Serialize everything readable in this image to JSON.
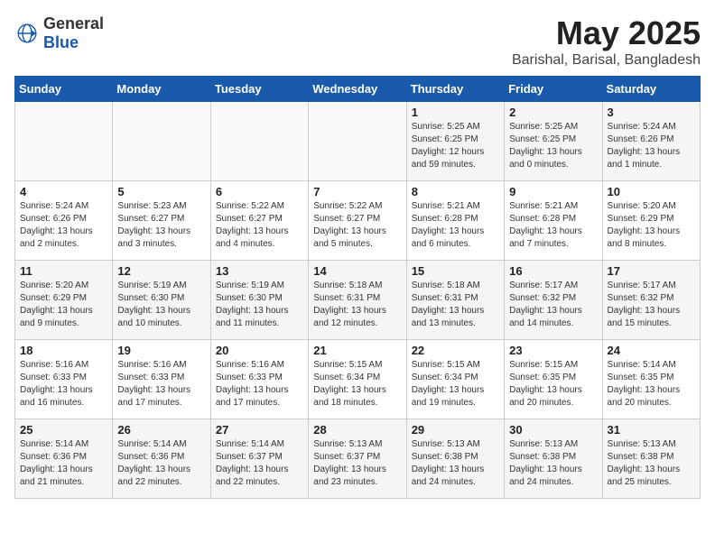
{
  "logo": {
    "text_general": "General",
    "text_blue": "Blue"
  },
  "header": {
    "month_title": "May 2025",
    "location": "Barishal, Barisal, Bangladesh"
  },
  "weekdays": [
    "Sunday",
    "Monday",
    "Tuesday",
    "Wednesday",
    "Thursday",
    "Friday",
    "Saturday"
  ],
  "weeks": [
    [
      {
        "day": "",
        "info": ""
      },
      {
        "day": "",
        "info": ""
      },
      {
        "day": "",
        "info": ""
      },
      {
        "day": "",
        "info": ""
      },
      {
        "day": "1",
        "info": "Sunrise: 5:25 AM\nSunset: 6:25 PM\nDaylight: 12 hours\nand 59 minutes."
      },
      {
        "day": "2",
        "info": "Sunrise: 5:25 AM\nSunset: 6:25 PM\nDaylight: 13 hours\nand 0 minutes."
      },
      {
        "day": "3",
        "info": "Sunrise: 5:24 AM\nSunset: 6:26 PM\nDaylight: 13 hours\nand 1 minute."
      }
    ],
    [
      {
        "day": "4",
        "info": "Sunrise: 5:24 AM\nSunset: 6:26 PM\nDaylight: 13 hours\nand 2 minutes."
      },
      {
        "day": "5",
        "info": "Sunrise: 5:23 AM\nSunset: 6:27 PM\nDaylight: 13 hours\nand 3 minutes."
      },
      {
        "day": "6",
        "info": "Sunrise: 5:22 AM\nSunset: 6:27 PM\nDaylight: 13 hours\nand 4 minutes."
      },
      {
        "day": "7",
        "info": "Sunrise: 5:22 AM\nSunset: 6:27 PM\nDaylight: 13 hours\nand 5 minutes."
      },
      {
        "day": "8",
        "info": "Sunrise: 5:21 AM\nSunset: 6:28 PM\nDaylight: 13 hours\nand 6 minutes."
      },
      {
        "day": "9",
        "info": "Sunrise: 5:21 AM\nSunset: 6:28 PM\nDaylight: 13 hours\nand 7 minutes."
      },
      {
        "day": "10",
        "info": "Sunrise: 5:20 AM\nSunset: 6:29 PM\nDaylight: 13 hours\nand 8 minutes."
      }
    ],
    [
      {
        "day": "11",
        "info": "Sunrise: 5:20 AM\nSunset: 6:29 PM\nDaylight: 13 hours\nand 9 minutes."
      },
      {
        "day": "12",
        "info": "Sunrise: 5:19 AM\nSunset: 6:30 PM\nDaylight: 13 hours\nand 10 minutes."
      },
      {
        "day": "13",
        "info": "Sunrise: 5:19 AM\nSunset: 6:30 PM\nDaylight: 13 hours\nand 11 minutes."
      },
      {
        "day": "14",
        "info": "Sunrise: 5:18 AM\nSunset: 6:31 PM\nDaylight: 13 hours\nand 12 minutes."
      },
      {
        "day": "15",
        "info": "Sunrise: 5:18 AM\nSunset: 6:31 PM\nDaylight: 13 hours\nand 13 minutes."
      },
      {
        "day": "16",
        "info": "Sunrise: 5:17 AM\nSunset: 6:32 PM\nDaylight: 13 hours\nand 14 minutes."
      },
      {
        "day": "17",
        "info": "Sunrise: 5:17 AM\nSunset: 6:32 PM\nDaylight: 13 hours\nand 15 minutes."
      }
    ],
    [
      {
        "day": "18",
        "info": "Sunrise: 5:16 AM\nSunset: 6:33 PM\nDaylight: 13 hours\nand 16 minutes."
      },
      {
        "day": "19",
        "info": "Sunrise: 5:16 AM\nSunset: 6:33 PM\nDaylight: 13 hours\nand 17 minutes."
      },
      {
        "day": "20",
        "info": "Sunrise: 5:16 AM\nSunset: 6:33 PM\nDaylight: 13 hours\nand 17 minutes."
      },
      {
        "day": "21",
        "info": "Sunrise: 5:15 AM\nSunset: 6:34 PM\nDaylight: 13 hours\nand 18 minutes."
      },
      {
        "day": "22",
        "info": "Sunrise: 5:15 AM\nSunset: 6:34 PM\nDaylight: 13 hours\nand 19 minutes."
      },
      {
        "day": "23",
        "info": "Sunrise: 5:15 AM\nSunset: 6:35 PM\nDaylight: 13 hours\nand 20 minutes."
      },
      {
        "day": "24",
        "info": "Sunrise: 5:14 AM\nSunset: 6:35 PM\nDaylight: 13 hours\nand 20 minutes."
      }
    ],
    [
      {
        "day": "25",
        "info": "Sunrise: 5:14 AM\nSunset: 6:36 PM\nDaylight: 13 hours\nand 21 minutes."
      },
      {
        "day": "26",
        "info": "Sunrise: 5:14 AM\nSunset: 6:36 PM\nDaylight: 13 hours\nand 22 minutes."
      },
      {
        "day": "27",
        "info": "Sunrise: 5:14 AM\nSunset: 6:37 PM\nDaylight: 13 hours\nand 22 minutes."
      },
      {
        "day": "28",
        "info": "Sunrise: 5:13 AM\nSunset: 6:37 PM\nDaylight: 13 hours\nand 23 minutes."
      },
      {
        "day": "29",
        "info": "Sunrise: 5:13 AM\nSunset: 6:38 PM\nDaylight: 13 hours\nand 24 minutes."
      },
      {
        "day": "30",
        "info": "Sunrise: 5:13 AM\nSunset: 6:38 PM\nDaylight: 13 hours\nand 24 minutes."
      },
      {
        "day": "31",
        "info": "Sunrise: 5:13 AM\nSunset: 6:38 PM\nDaylight: 13 hours\nand 25 minutes."
      }
    ]
  ]
}
